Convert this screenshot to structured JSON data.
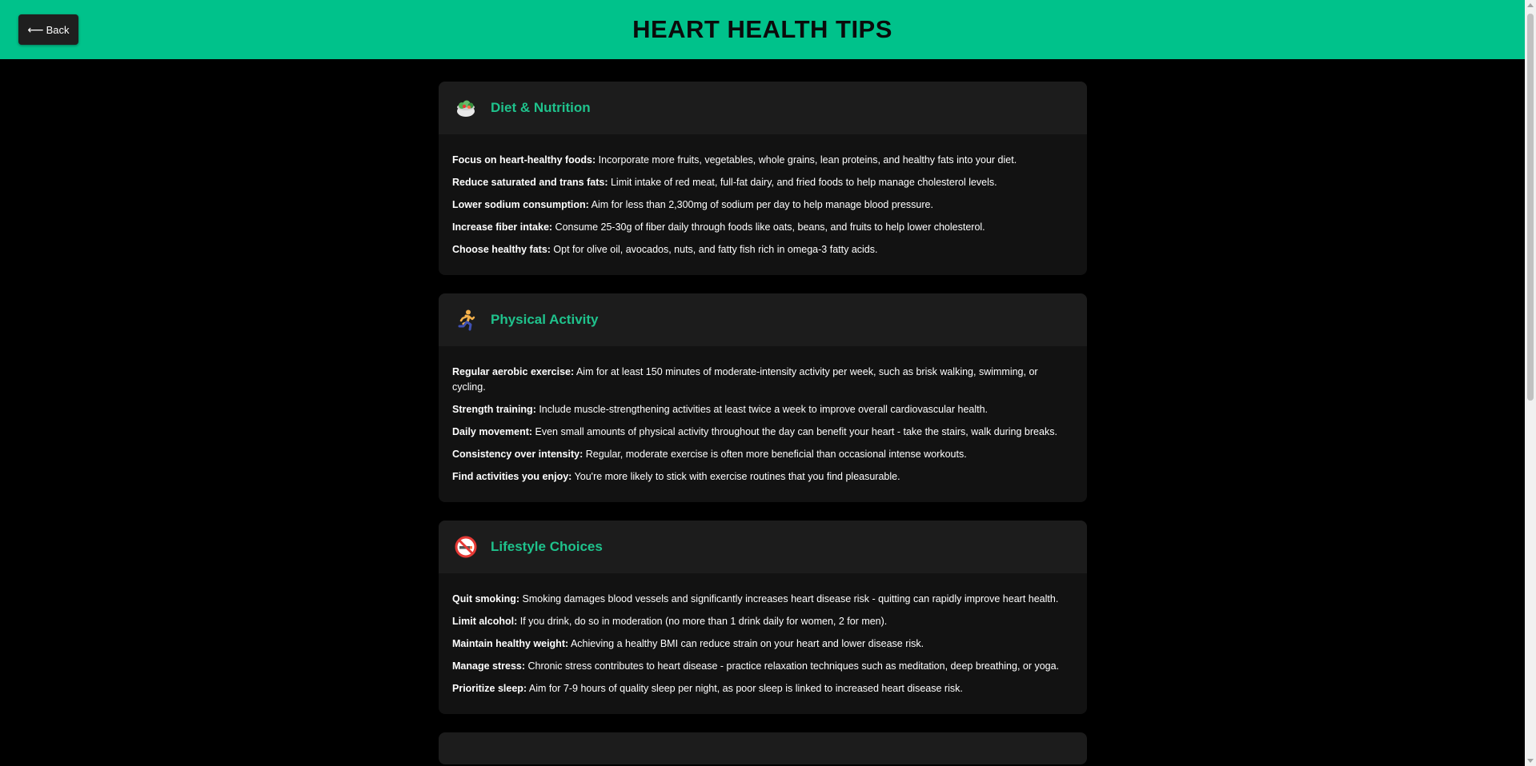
{
  "header": {
    "back_label": "Back",
    "back_arrow": "⟵",
    "title": "HEART HEALTH TIPS",
    "accent_color": "#00c28b"
  },
  "sections": [
    {
      "icon": "salad-icon",
      "title": "Diet & Nutrition",
      "tips": [
        {
          "label": "Focus on heart-healthy foods:",
          "text": " Incorporate more fruits, vegetables, whole grains, lean proteins, and healthy fats into your diet."
        },
        {
          "label": "Reduce saturated and trans fats:",
          "text": " Limit intake of red meat, full-fat dairy, and fried foods to help manage cholesterol levels."
        },
        {
          "label": "Lower sodium consumption:",
          "text": " Aim for less than 2,300mg of sodium per day to help manage blood pressure."
        },
        {
          "label": "Increase fiber intake:",
          "text": " Consume 25-30g of fiber daily through foods like oats, beans, and fruits to help lower cholesterol."
        },
        {
          "label": "Choose healthy fats:",
          "text": " Opt for olive oil, avocados, nuts, and fatty fish rich in omega-3 fatty acids."
        }
      ]
    },
    {
      "icon": "running-person-icon",
      "title": "Physical Activity",
      "tips": [
        {
          "label": "Regular aerobic exercise:",
          "text": " Aim for at least 150 minutes of moderate-intensity activity per week, such as brisk walking, swimming, or cycling."
        },
        {
          "label": "Strength training:",
          "text": " Include muscle-strengthening activities at least twice a week to improve overall cardiovascular health."
        },
        {
          "label": "Daily movement:",
          "text": " Even small amounts of physical activity throughout the day can benefit your heart - take the stairs, walk during breaks."
        },
        {
          "label": "Consistency over intensity:",
          "text": " Regular, moderate exercise is often more beneficial than occasional intense workouts."
        },
        {
          "label": "Find activities you enjoy:",
          "text": " You're more likely to stick with exercise routines that you find pleasurable."
        }
      ]
    },
    {
      "icon": "no-smoking-icon",
      "title": "Lifestyle Choices",
      "tips": [
        {
          "label": "Quit smoking:",
          "text": " Smoking damages blood vessels and significantly increases heart disease risk - quitting can rapidly improve heart health."
        },
        {
          "label": "Limit alcohol:",
          "text": " If you drink, do so in moderation (no more than 1 drink daily for women, 2 for men)."
        },
        {
          "label": "Maintain healthy weight:",
          "text": " Achieving a healthy BMI can reduce strain on your heart and lower disease risk."
        },
        {
          "label": "Manage stress:",
          "text": " Chronic stress contributes to heart disease - practice relaxation techniques such as meditation, deep breathing, or yoga."
        },
        {
          "label": "Prioritize sleep:",
          "text": " Aim for 7-9 hours of quality sleep per night, as poor sleep is linked to increased heart disease risk."
        }
      ]
    }
  ]
}
